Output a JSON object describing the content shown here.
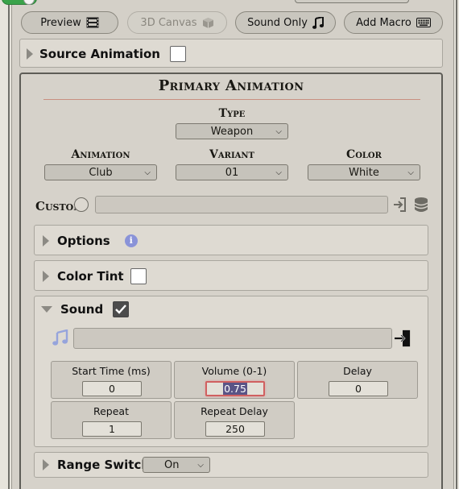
{
  "toolbar": {
    "preview_label": "Preview",
    "canvas_label": "3D Canvas",
    "sound_only_label": "Sound Only",
    "add_macro_label": "Add Macro"
  },
  "source_animation": {
    "label": "Source Animation",
    "checked": false
  },
  "primary": {
    "title": "Primary Animation",
    "type_label": "Type",
    "type_value": "Weapon",
    "animation_label": "Animation",
    "animation_value": "Club",
    "variant_label": "Variant",
    "variant_value": "01",
    "color_label": "Color",
    "color_value": "White",
    "custom_label": "Custom"
  },
  "options": {
    "label": "Options",
    "info": "i"
  },
  "color_tint": {
    "label": "Color Tint",
    "checked": false
  },
  "sound": {
    "label": "Sound",
    "checked": true,
    "start_time_label": "Start Time (ms)",
    "start_time_value": "0",
    "volume_label": "Volume (0-1)",
    "volume_value": "0.75",
    "delay_label": "Delay",
    "delay_value": "0",
    "repeat_label": "Repeat",
    "repeat_value": "1",
    "repeat_delay_label": "Repeat Delay",
    "repeat_delay_value": "250"
  },
  "range_switch": {
    "label": "Range Switch",
    "value": "On"
  },
  "colors": {
    "toggle_on": "#3aa34a",
    "info_badge": "#8a93d8",
    "focus_ring": "#d06060"
  }
}
